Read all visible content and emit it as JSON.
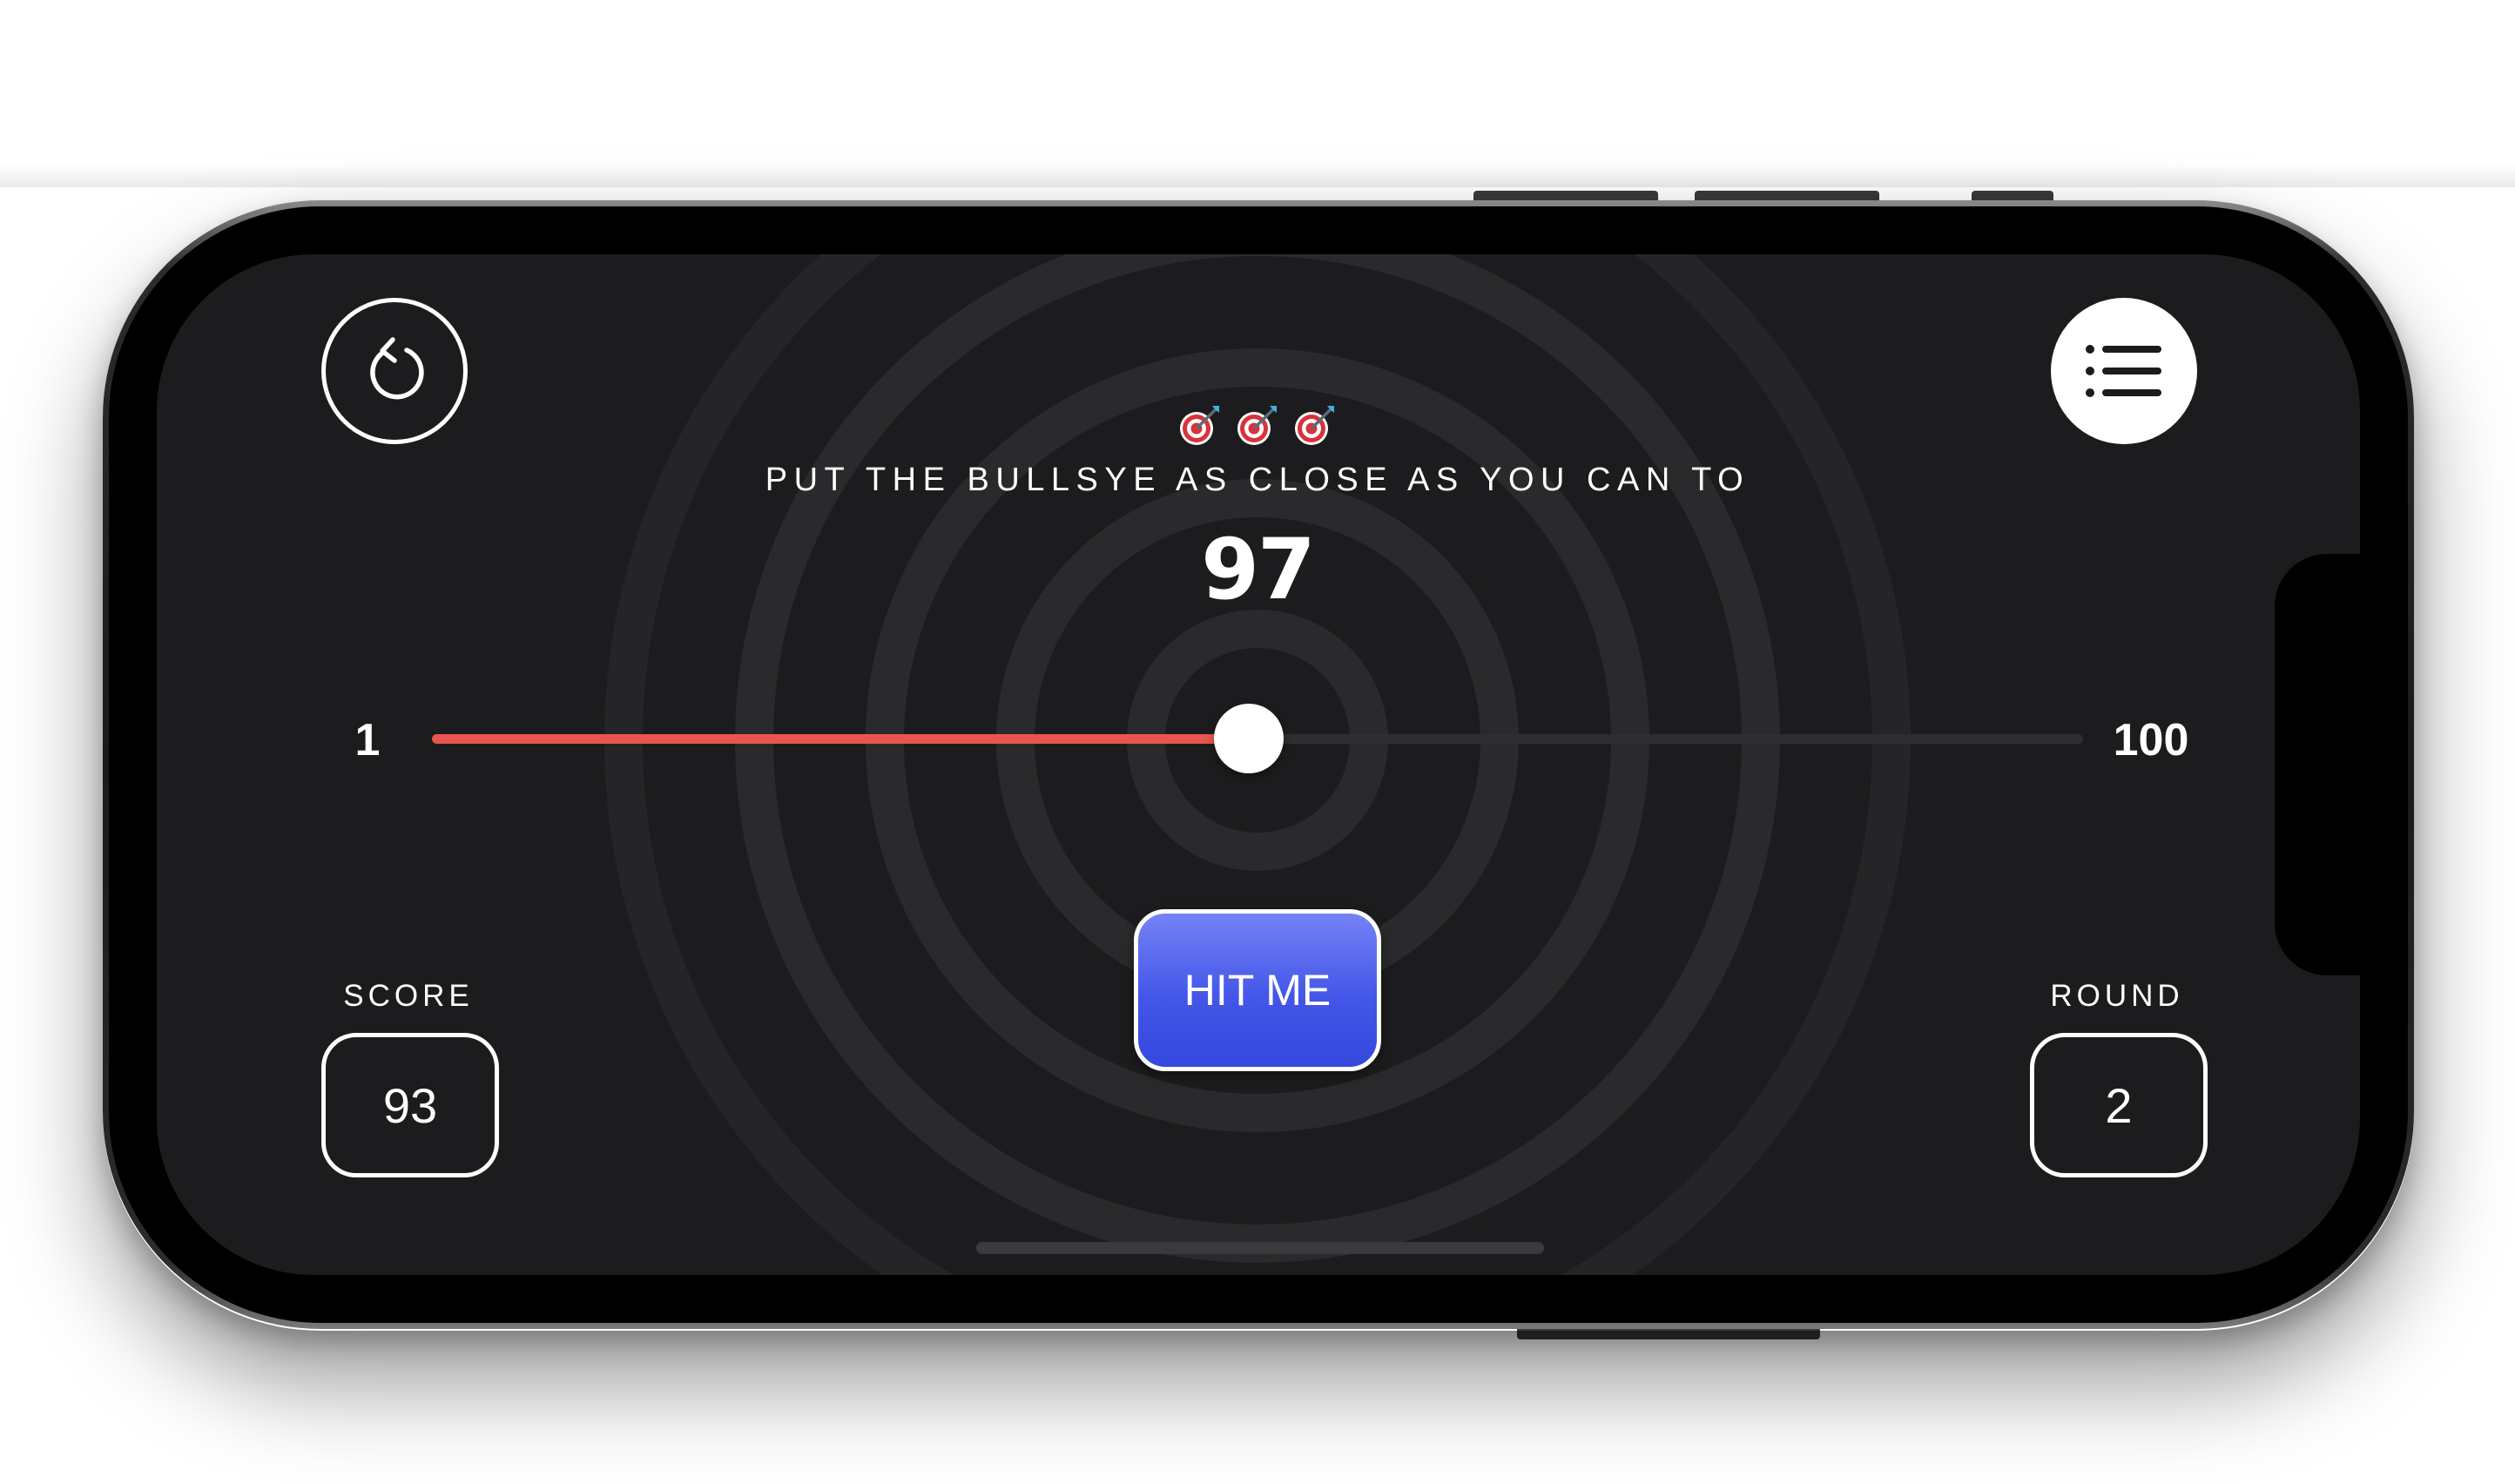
{
  "header": {
    "restart_icon": "restart-icon",
    "leaderboard_icon": "list-icon"
  },
  "game": {
    "emoji_icons": [
      "direct-hit-icon",
      "direct-hit-icon",
      "direct-hit-icon"
    ],
    "instruction": "PUT THE BULLSYE AS CLOSE AS YOU CAN TO",
    "target_value": "97"
  },
  "slider": {
    "min_label": "1",
    "max_label": "100",
    "value": 50
  },
  "actions": {
    "hit_label": "HIT ME"
  },
  "stats": {
    "score_label": "SCORE",
    "score_value": "93",
    "round_label": "ROUND",
    "round_value": "2"
  },
  "colors": {
    "background": "#1c1c1e",
    "ring": "#2a2a2d",
    "slider_fill": "#e8564e",
    "slider_track": "#2e2e30",
    "button_top": "#7583f6",
    "button_bottom": "#3548de",
    "text": "#ffffff"
  }
}
